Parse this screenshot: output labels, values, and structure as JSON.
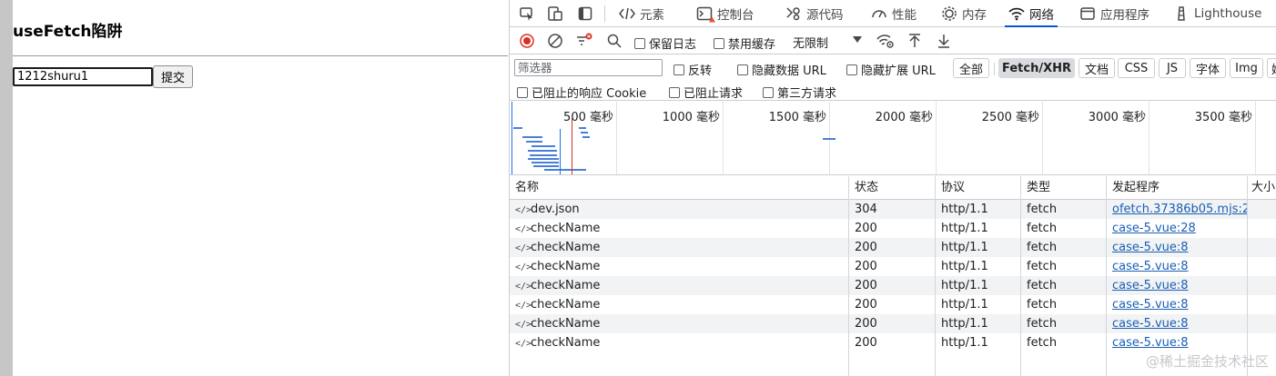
{
  "page": {
    "title": "useFetch陷阱",
    "input_value": "1212shuru1",
    "submit_label": "提交"
  },
  "devtools": {
    "tabs": [
      {
        "label": "元素",
        "icon": "code-icon"
      },
      {
        "label": "控制台",
        "icon": "console-icon"
      },
      {
        "label": "源代码",
        "icon": "sources-icon"
      },
      {
        "label": "性能",
        "icon": "performance-icon"
      },
      {
        "label": "内存",
        "icon": "memory-icon"
      },
      {
        "label": "网络",
        "icon": "wifi-icon"
      },
      {
        "label": "应用程序",
        "icon": "application-icon"
      },
      {
        "label": "Lighthouse",
        "icon": "lighthouse-icon"
      }
    ],
    "active_tab": "网络",
    "toolbar": {
      "preserve_log": "保留日志",
      "disable_cache": "禁用缓存",
      "throttling": "无限制"
    },
    "filter": {
      "placeholder": "筛选器",
      "invert": "反转",
      "hide_data_urls": "隐藏数据 URL",
      "hide_extension_urls": "隐藏扩展 URL",
      "types": [
        "全部",
        "Fetch/XHR",
        "文档",
        "CSS",
        "JS",
        "字体",
        "Img",
        "媒"
      ],
      "selected_type": "Fetch/XHR",
      "blocked_response_cookies": "已阻止的响应 Cookie",
      "blocked_requests": "已阻止请求",
      "third_party_requests": "第三方请求"
    },
    "overview": {
      "ticks": [
        "500  毫秒",
        "1000  毫秒",
        "1500  毫秒",
        "2000  毫秒",
        "2500  毫秒",
        "3000  毫秒",
        "3500  毫秒"
      ]
    },
    "table": {
      "columns": [
        "名称",
        "状态",
        "协议",
        "类型",
        "发起程序",
        "大小"
      ],
      "rows": [
        {
          "name": "dev.json",
          "status": "304",
          "protocol": "http/1.1",
          "type": "fetch",
          "initiator": "ofetch.37386b05.mjs:2"
        },
        {
          "name": "checkName",
          "status": "200",
          "protocol": "http/1.1",
          "type": "fetch",
          "initiator": "case-5.vue:28"
        },
        {
          "name": "checkName",
          "status": "200",
          "protocol": "http/1.1",
          "type": "fetch",
          "initiator": "case-5.vue:8"
        },
        {
          "name": "checkName",
          "status": "200",
          "protocol": "http/1.1",
          "type": "fetch",
          "initiator": "case-5.vue:8"
        },
        {
          "name": "checkName",
          "status": "200",
          "protocol": "http/1.1",
          "type": "fetch",
          "initiator": "case-5.vue:8"
        },
        {
          "name": "checkName",
          "status": "200",
          "protocol": "http/1.1",
          "type": "fetch",
          "initiator": "case-5.vue:8"
        },
        {
          "name": "checkName",
          "status": "200",
          "protocol": "http/1.1",
          "type": "fetch",
          "initiator": "case-5.vue:8"
        },
        {
          "name": "checkName",
          "status": "200",
          "protocol": "http/1.1",
          "type": "fetch",
          "initiator": "case-5.vue:8"
        }
      ]
    }
  },
  "watermark": "@稀土掘金技术社区",
  "colors": {
    "accent": "#0b57d0",
    "link": "#1a5fb4",
    "record_red": "#d93025"
  }
}
